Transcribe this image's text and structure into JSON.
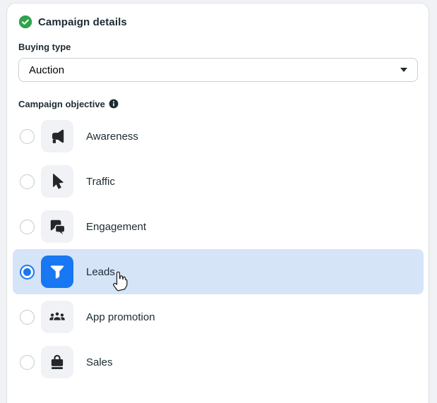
{
  "card": {
    "title": "Campaign details",
    "status_icon": "check-circle-icon"
  },
  "buying_type": {
    "label": "Buying type",
    "value": "Auction",
    "caret_icon": "caret-down-icon"
  },
  "objective": {
    "label": "Campaign objective",
    "info_icon": "info-icon",
    "options": [
      {
        "label": "Awareness",
        "icon": "megaphone-icon",
        "selected": false
      },
      {
        "label": "Traffic",
        "icon": "cursor-arrow-icon",
        "selected": false
      },
      {
        "label": "Engagement",
        "icon": "chat-bubbles-icon",
        "selected": false
      },
      {
        "label": "Leads",
        "icon": "funnel-icon",
        "selected": true
      },
      {
        "label": "App promotion",
        "icon": "people-group-icon",
        "selected": false
      },
      {
        "label": "Sales",
        "icon": "shopping-bag-icon",
        "selected": false
      }
    ]
  },
  "cursor": {
    "type": "hand-pointer"
  },
  "colors": {
    "accent_blue": "#1877F2",
    "selected_row_bg": "#D6E4F8",
    "success_green": "#31A24C",
    "tile_gray": "#F0F2F5",
    "page_bg": "#F0F2F5",
    "text_primary": "#1C2B33"
  }
}
